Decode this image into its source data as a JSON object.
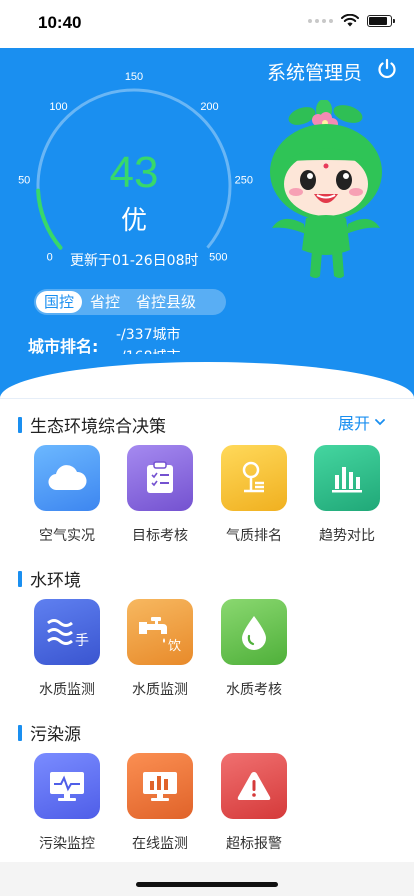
{
  "status": {
    "time": "10:40",
    "battery_level": 0.85
  },
  "header": {
    "admin_label": "系统管理员",
    "power_icon": "power-icon"
  },
  "gauge": {
    "value": "43",
    "level": "优",
    "updated": "更新于01-26日08时",
    "ticks": [
      "0",
      "50",
      "100",
      "150",
      "200",
      "250",
      "500"
    ],
    "value_numeric": 43,
    "max": 500,
    "value_color": "#38d86a"
  },
  "tabs": [
    {
      "label": "国控",
      "active": true
    },
    {
      "label": "省控",
      "active": false
    },
    {
      "label": "省控县级",
      "active": false
    }
  ],
  "ranking": {
    "label": "城市排名:",
    "line1": "-/337城市",
    "line2": "-/168城市"
  },
  "sections": [
    {
      "title": "生态环境综合决策",
      "expand_label": "展开",
      "items": [
        {
          "label": "空气实况",
          "icon": "cloud-icon"
        },
        {
          "label": "目标考核",
          "icon": "clipboard-icon"
        },
        {
          "label": "气质排名",
          "icon": "ranking-icon"
        },
        {
          "label": "趋势对比",
          "icon": "bar-chart-icon"
        }
      ]
    },
    {
      "title": "水环境",
      "items": [
        {
          "label": "水质监测",
          "icon": "water-waves-icon",
          "badge": "手"
        },
        {
          "label": "水质监测",
          "icon": "faucet-icon",
          "badge": "饮"
        },
        {
          "label": "水质考核",
          "icon": "water-drop-icon"
        }
      ]
    },
    {
      "title": "污染源",
      "items": [
        {
          "label": "污染监控",
          "icon": "monitor-pulse-icon"
        },
        {
          "label": "在线监测",
          "icon": "monitor-chart-icon"
        },
        {
          "label": "超标报警",
          "icon": "warning-icon"
        }
      ]
    }
  ],
  "colors": {
    "primary": "#1a8ff0",
    "tile_gradients": [
      "#5aa8f8",
      "#8a6fe0",
      "#f6c23c",
      "#2fbf8a",
      "#4a6fe0",
      "#f0a040",
      "#6cc850",
      "#5a6ef0",
      "#f07a3c",
      "#e84a4a"
    ]
  }
}
